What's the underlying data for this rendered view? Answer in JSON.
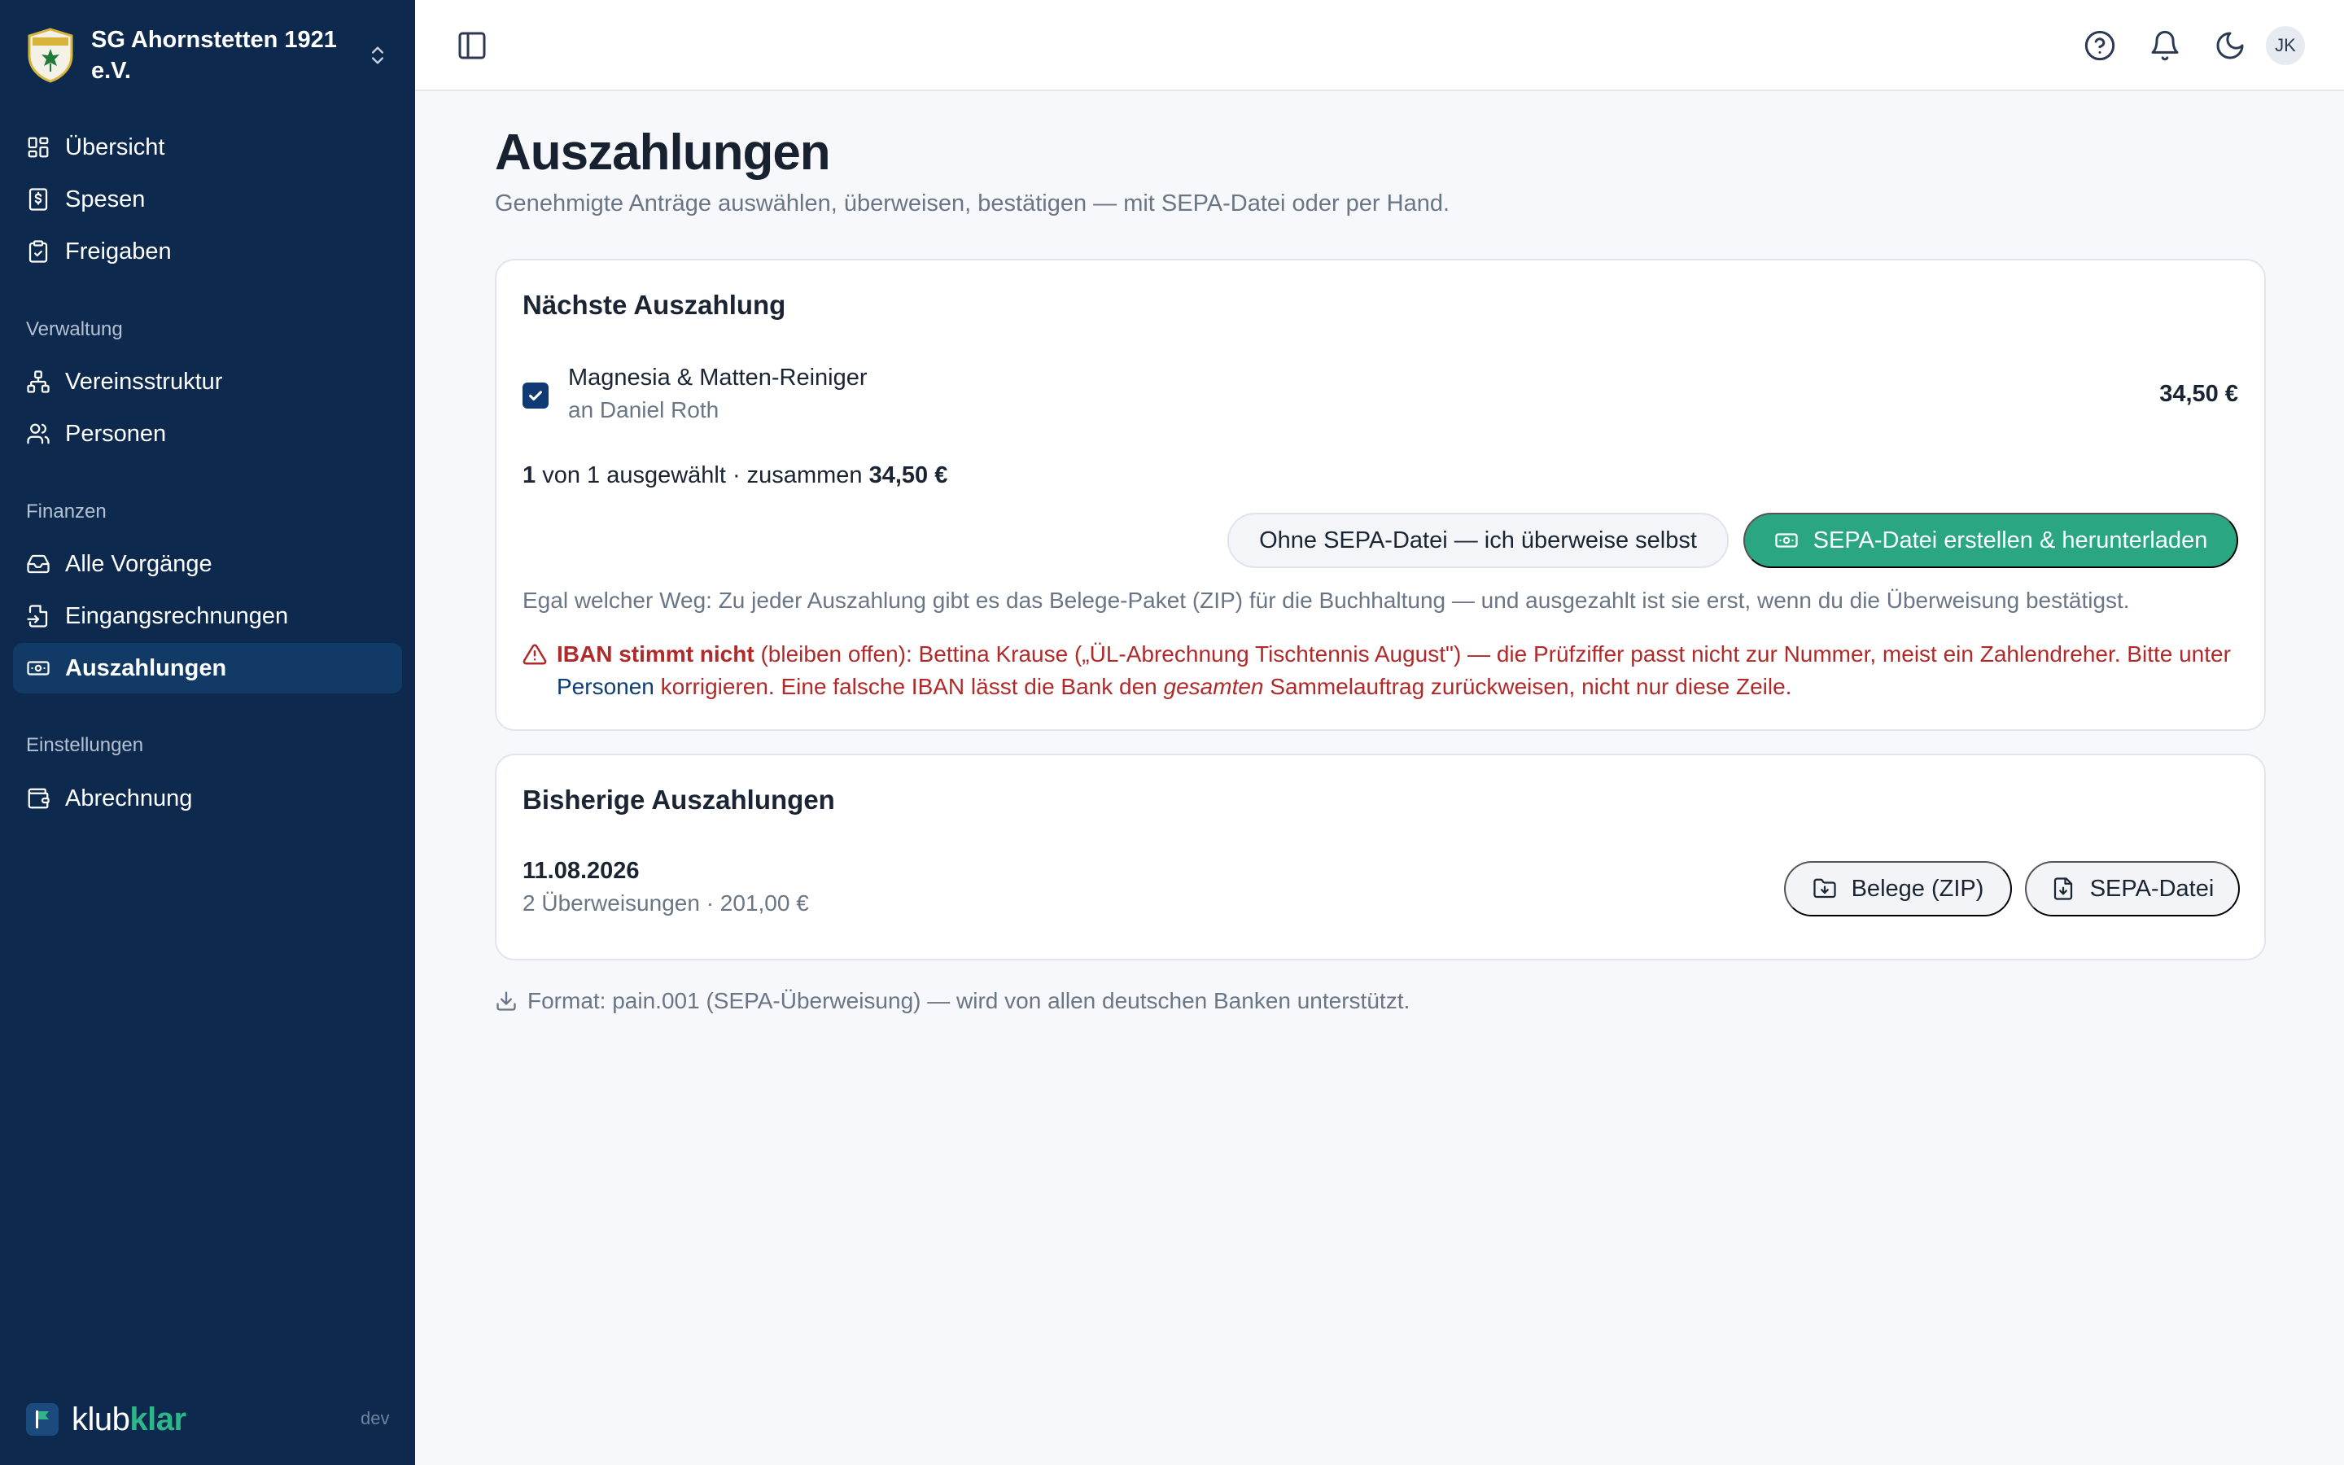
{
  "sidebar": {
    "org_name": "SG Ahornstetten 1921 e.V.",
    "items": [
      {
        "label": "Übersicht",
        "icon": "dashboard-icon"
      },
      {
        "label": "Spesen",
        "icon": "receipt-icon"
      },
      {
        "label": "Freigaben",
        "icon": "clipboard-check-icon"
      }
    ],
    "sections": [
      {
        "title": "Verwaltung",
        "items": [
          {
            "label": "Vereinsstruktur",
            "icon": "network-icon"
          },
          {
            "label": "Personen",
            "icon": "users-icon"
          }
        ]
      },
      {
        "title": "Finanzen",
        "items": [
          {
            "label": "Alle Vorgänge",
            "icon": "inbox-icon"
          },
          {
            "label": "Eingangsrechnungen",
            "icon": "file-import-icon"
          },
          {
            "label": "Auszahlungen",
            "icon": "banknote-icon",
            "active": true
          }
        ]
      },
      {
        "title": "Einstellungen",
        "items": [
          {
            "label": "Abrechnung",
            "icon": "wallet-icon"
          }
        ]
      }
    ],
    "brand": {
      "prefix": "klub",
      "accent": "klar",
      "env": "dev"
    }
  },
  "topbar": {
    "avatar_initials": "JK",
    "icons": [
      "sidebar-toggle-icon",
      "help-icon",
      "bell-icon",
      "moon-icon"
    ]
  },
  "page": {
    "title": "Auszahlungen",
    "subtitle": "Genehmigte Anträge auswählen, überweisen, bestätigen — mit SEPA-Datei oder per Hand."
  },
  "next_payout": {
    "title": "Nächste Auszahlung",
    "item": {
      "title": "Magnesia & Matten-Reiniger",
      "recipient": "an Daniel Roth",
      "amount": "34,50 €",
      "selected": true
    },
    "summary": {
      "selected_count": "1",
      "text_mid": " von 1 ausgewählt · zusammen ",
      "total": "34,50 €"
    },
    "manual_button": "Ohne SEPA-Datei — ich überweise selbst",
    "sepa_button": "SEPA-Datei erstellen & herunterladen",
    "hint": "Egal welcher Weg: Zu jeder Auszahlung gibt es das Belege-Paket (ZIP) für die Buchhaltung — und ausgezahlt ist sie erst, wenn du die Überweisung bestätigst.",
    "alert": {
      "strong": "IBAN stimmt nicht",
      "text1": " (bleiben offen): Bettina Krause („ÜL-Abrechnung Tischtennis August\") — die Prüfziffer passt nicht zur Nummer, meist ein Zahlendreher. Bitte unter ",
      "link": "Personen",
      "text2": " korrigieren. Eine falsche IBAN lässt die Bank den ",
      "emphasis": "gesamten",
      "text3": " Sammelauftrag zurückweisen, nicht nur diese Zeile."
    }
  },
  "history": {
    "title": "Bisherige Auszahlungen",
    "entries": [
      {
        "date": "11.08.2026",
        "details": "2 Überweisungen · 201,00 €",
        "receipts_button": "Belege (ZIP)",
        "sepa_button": "SEPA-Datei"
      }
    ]
  },
  "footnote": "Format: pain.001 (SEPA-Überweisung) — wird von allen deutschen Banken unterstützt.",
  "colors": {
    "sidebar_bg": "#0d2a4e",
    "sidebar_active": "#123a67",
    "primary_green": "#2aa683",
    "error_red": "#b12a2a",
    "checkbox_blue": "#0f3a73"
  }
}
